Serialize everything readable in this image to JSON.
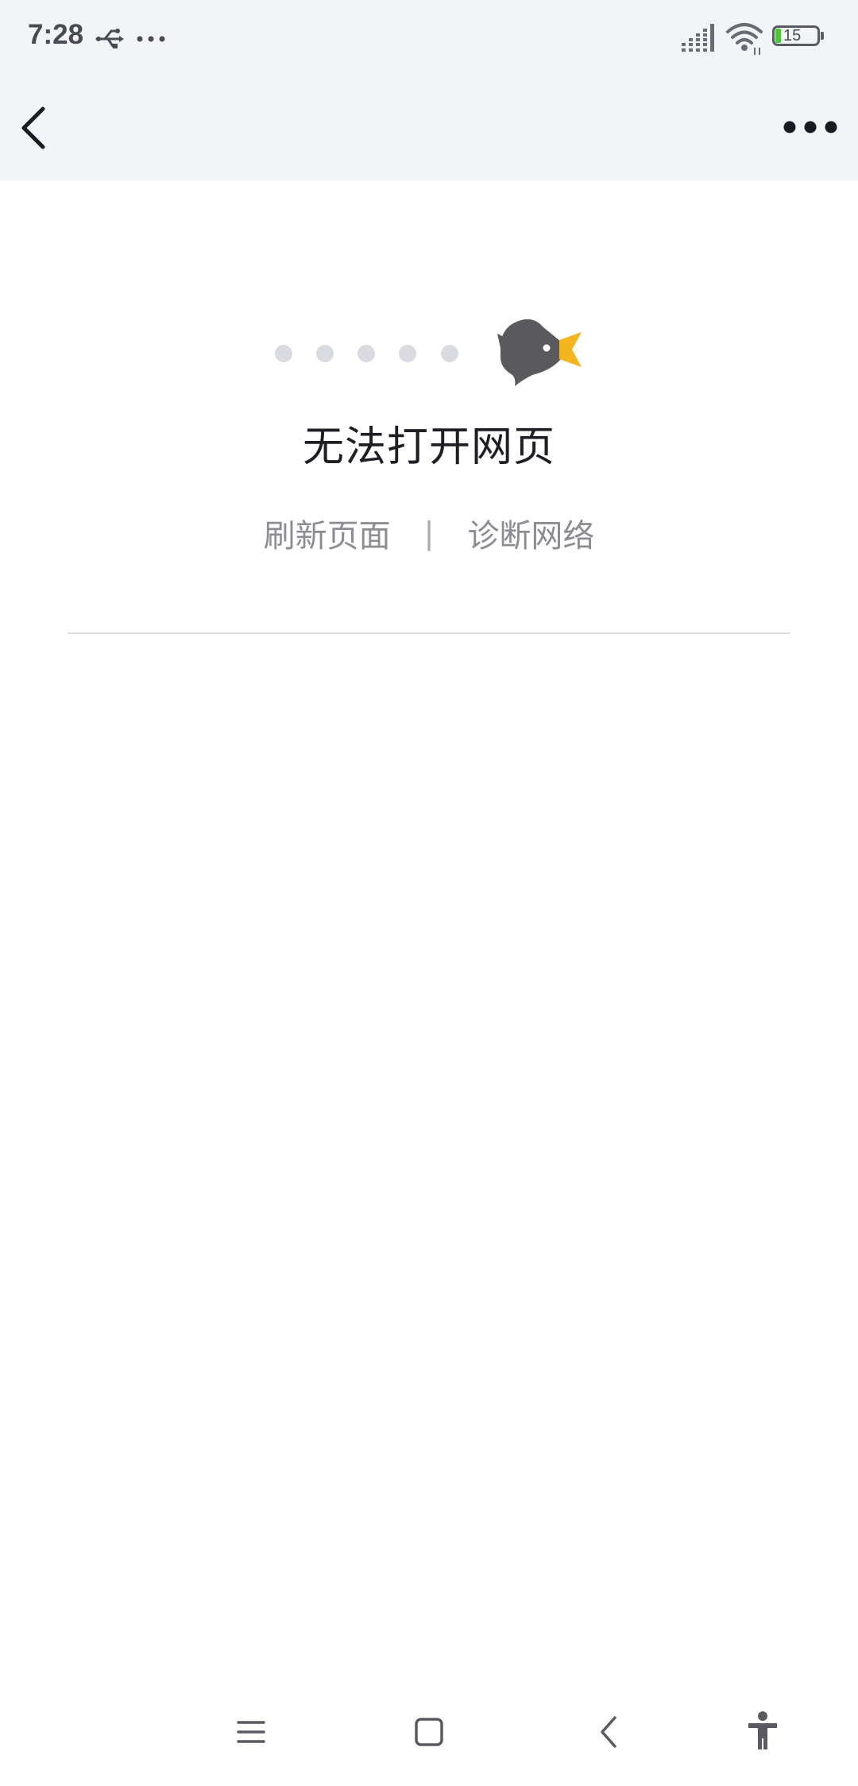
{
  "status_bar": {
    "time": "7:28",
    "battery_level": "15",
    "icons": [
      "usb-icon",
      "more-status-icon",
      "signal-icon",
      "wifi-icon",
      "battery-icon"
    ]
  },
  "nav_bar": {
    "back_icon": "chevron-left-icon",
    "menu_icon": "more-horizontal-icon"
  },
  "error": {
    "title": "无法打开网页",
    "refresh_label": "刷新页面",
    "separator": "|",
    "diagnose_label": "诊断网络",
    "illustration_icon": "bird-icon"
  },
  "system_nav": {
    "items": [
      "menu-icon",
      "home-icon",
      "back-icon",
      "accessibility-icon"
    ]
  },
  "colors": {
    "header_bg": "#f3f4f8",
    "title_text": "#1e1e24",
    "link_text": "#8c8c92",
    "bird": "#5a5a5e",
    "beak": "#f3b61f",
    "dots": "#d9dbe1",
    "battery_fill": "#4cc53a"
  }
}
